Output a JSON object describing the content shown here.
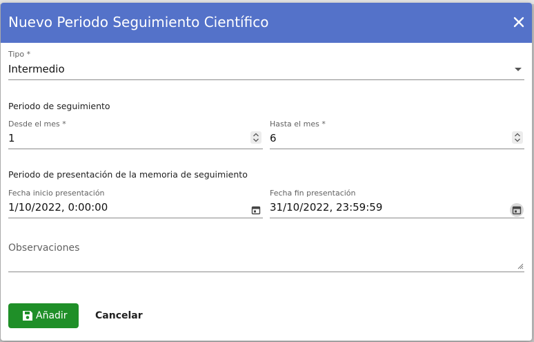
{
  "dialog": {
    "title": "Nuevo Periodo Seguimiento Científico",
    "header_color": "#5472c9",
    "close_icon": "close-icon"
  },
  "form": {
    "tipo": {
      "label": "Tipo *",
      "value": "Intermedio"
    },
    "periodo_seguimiento": {
      "heading": "Periodo de seguimiento",
      "desde": {
        "label": "Desde el mes *",
        "value": "1"
      },
      "hasta": {
        "label": "Hasta el mes *",
        "value": "6"
      }
    },
    "periodo_presentacion": {
      "heading": "Periodo de presentación de la memoria de seguimiento",
      "inicio": {
        "label": "Fecha inicio presentación",
        "value": "1/10/2022, 0:00:00"
      },
      "fin": {
        "label": "Fecha fin presentación",
        "value": "31/10/2022, 23:59:59"
      }
    },
    "observaciones": {
      "placeholder": "Observaciones",
      "value": ""
    }
  },
  "actions": {
    "add_label": "Añadir",
    "add_color": "#1f8f28",
    "add_icon": "save-icon",
    "cancel_label": "Cancelar"
  }
}
